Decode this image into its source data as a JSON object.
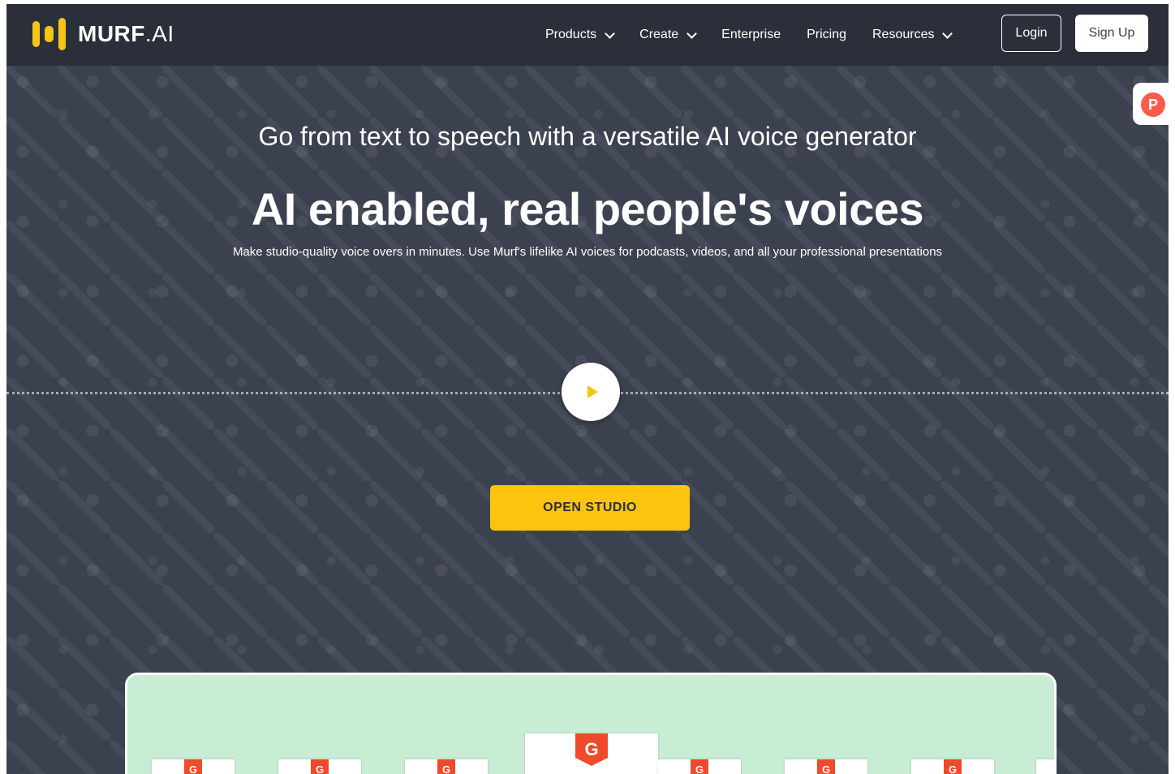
{
  "nav": {
    "logo_bold": "MURF",
    "logo_light": ".AI",
    "items": [
      {
        "label": "Products",
        "dropdown": true
      },
      {
        "label": "Create",
        "dropdown": true
      },
      {
        "label": "Enterprise",
        "dropdown": false
      },
      {
        "label": "Pricing",
        "dropdown": false
      },
      {
        "label": "Resources",
        "dropdown": true
      }
    ],
    "login_label": "Login",
    "signup_label": "Sign Up"
  },
  "side_badge": {
    "letter": "P"
  },
  "hero": {
    "subtitle": "Go from text to speech with a versatile AI voice generator",
    "headline": "AI enabled, real people's voices",
    "description": "Make studio-quality voice overs in minutes. Use Murf's lifelike AI voices for podcasts, videos, and all your professional presentations",
    "cta_label": "OPEN STUDIO"
  },
  "awards": {
    "badge_letter": "G",
    "badges": [
      "G",
      "G",
      "G",
      "G",
      "G",
      "G",
      "G",
      "G"
    ]
  },
  "colors": {
    "background": "#3c4150",
    "nav": "#2b2f3a",
    "accent": "#fcc30f",
    "awards_panel": "#c8ecd4",
    "g2_red": "#ef4a2b"
  }
}
